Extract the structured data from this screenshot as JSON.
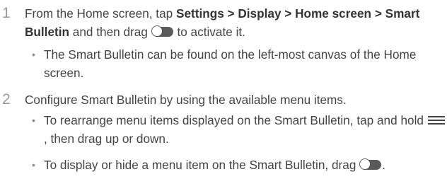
{
  "steps": [
    {
      "number": "1",
      "text": {
        "prefix": "From the Home screen, tap ",
        "path": "Settings > Display > Home screen > Smart Bulletin",
        "middle": " and then drag ",
        "suffix": " to activate it."
      },
      "bullets": [
        {
          "symbol": "•",
          "text": "The Smart Bulletin can be found on the left-most canvas of the Home screen."
        }
      ]
    },
    {
      "number": "2",
      "text": "Configure Smart Bulletin by using the available menu items.",
      "bullets": [
        {
          "symbol": "•",
          "before": "To rearrange menu items displayed on the Smart Bulletin, tap and hold ",
          "after": ", then drag up or down."
        },
        {
          "symbol": "•",
          "before": "To display or hide a menu item on the Smart Bulletin, drag ",
          "after": "."
        }
      ]
    }
  ],
  "icons": {
    "toggle": "toggle-switch-icon",
    "reorder": "reorder-handle-icon"
  }
}
